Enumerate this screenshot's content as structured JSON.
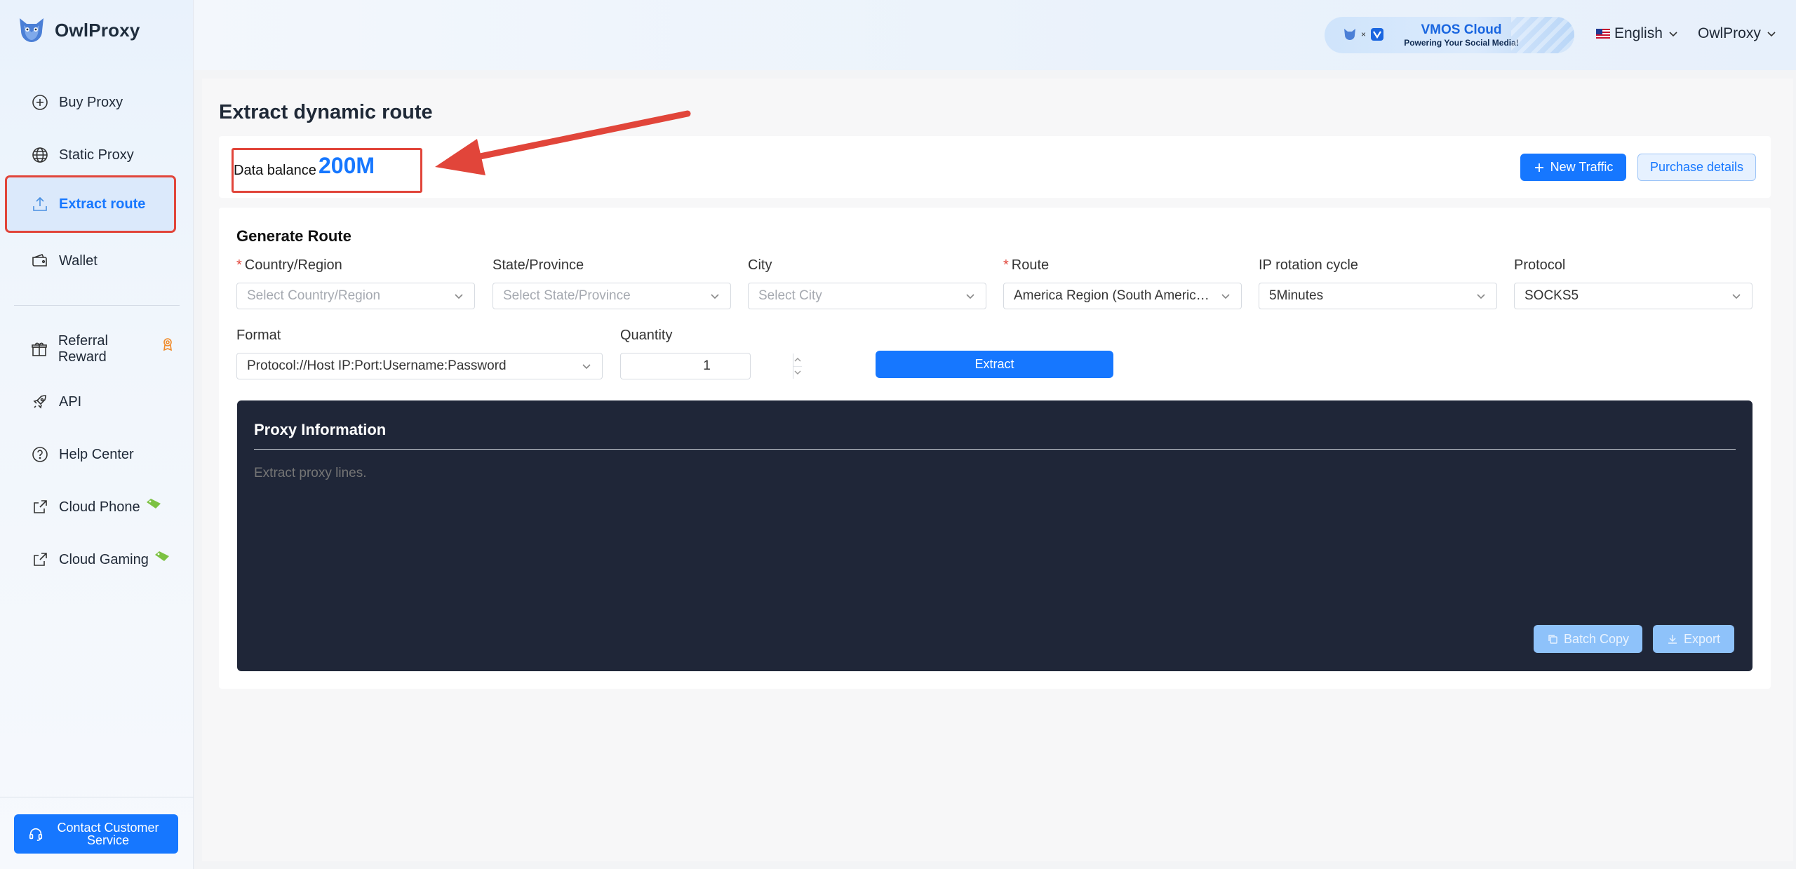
{
  "app": {
    "name": "OwlProxy"
  },
  "sidebar": {
    "items": [
      {
        "label": "Buy Proxy",
        "icon": "plus-circle-icon"
      },
      {
        "label": "Static Proxy",
        "icon": "globe-icon"
      },
      {
        "label": "Extract route",
        "icon": "upload-icon",
        "active": true
      },
      {
        "label": "Wallet",
        "icon": "wallet-icon"
      },
      {
        "label": "Referral Reward",
        "icon": "gift-icon",
        "badge": "award-badge-icon"
      },
      {
        "label": "API",
        "icon": "rocket-icon"
      },
      {
        "label": "Help Center",
        "icon": "question-circle-icon"
      },
      {
        "label": "Cloud Phone",
        "icon": "external-link-icon",
        "badge": "tag-icon"
      },
      {
        "label": "Cloud Gaming",
        "icon": "external-link-icon",
        "badge": "tag-icon"
      }
    ],
    "contact": "Contact Customer Service"
  },
  "header": {
    "banner_title": "VMOS Cloud",
    "banner_subtitle": "Powering Your Social Media!",
    "language": "English",
    "user": "OwlProxy"
  },
  "page": {
    "title": "Extract dynamic route"
  },
  "balance": {
    "label": "Data balance",
    "value": "200M",
    "new_traffic": "New Traffic",
    "purchase_details": "Purchase details"
  },
  "route": {
    "section_title": "Generate Route",
    "country_label": "Country/Region",
    "country_placeholder": "Select Country/Region",
    "state_label": "State/Province",
    "state_placeholder": "Select State/Province",
    "city_label": "City",
    "city_placeholder": "Select City",
    "route_label": "Route",
    "route_value": "America Region (South America...",
    "rotation_label": "IP rotation cycle",
    "rotation_value": "5Minutes",
    "protocol_label": "Protocol",
    "protocol_value": "SOCKS5",
    "format_label": "Format",
    "format_value": "Protocol://Host IP:Port:Username:Password",
    "quantity_label": "Quantity",
    "quantity_value": "1",
    "extract": "Extract"
  },
  "proxy": {
    "title": "Proxy Information",
    "placeholder": "Extract proxy lines.",
    "batch_copy": "Batch Copy",
    "export": "Export"
  },
  "colors": {
    "primary": "#1677ff",
    "highlight": "#e1453a",
    "panel": "#1f2638"
  }
}
